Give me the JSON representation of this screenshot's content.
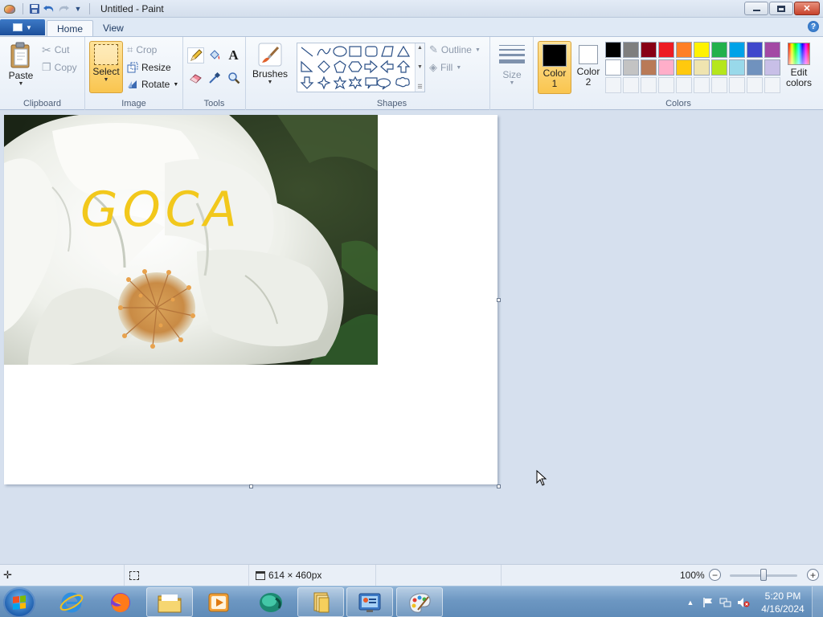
{
  "window": {
    "title": "Untitled - Paint"
  },
  "tabs": [
    {
      "label": "Home"
    },
    {
      "label": "View"
    }
  ],
  "ribbon": {
    "clipboard": {
      "group_label": "Clipboard",
      "paste_label": "Paste",
      "cut_label": "Cut",
      "copy_label": "Copy"
    },
    "image": {
      "group_label": "Image",
      "select_label": "Select",
      "crop_label": "Crop",
      "resize_label": "Resize",
      "rotate_label": "Rotate"
    },
    "tools": {
      "group_label": "Tools"
    },
    "brushes": {
      "label": "Brushes"
    },
    "shapes": {
      "group_label": "Shapes",
      "outline_label": "Outline",
      "fill_label": "Fill"
    },
    "size": {
      "label": "Size"
    },
    "colors": {
      "group_label": "Colors",
      "color1_label": "Color 1",
      "color2_label": "Color 2",
      "edit_colors_label": "Edit colors",
      "color1": "#000000",
      "color2": "#ffffff",
      "palette_row1": [
        "#000000",
        "#7f7f7f",
        "#880015",
        "#ed1c24",
        "#ff7f27",
        "#fff200",
        "#22b14c",
        "#00a2e8",
        "#3f48cc",
        "#a349a4"
      ],
      "palette_row2": [
        "#ffffff",
        "#c3c3c3",
        "#b97a57",
        "#ffaec9",
        "#ffc90e",
        "#efe4b0",
        "#b5e61d",
        "#99d9ea",
        "#7092be",
        "#c8bfe7"
      ]
    }
  },
  "canvas": {
    "overlay_text": "GOCA",
    "overlay_color": "#f2c81c"
  },
  "statusbar": {
    "dimensions": "614 × 460px",
    "zoom": "100%",
    "zoom_level": 0.5
  },
  "taskbar": {
    "time": "5:20 PM",
    "date": "4/16/2024"
  }
}
